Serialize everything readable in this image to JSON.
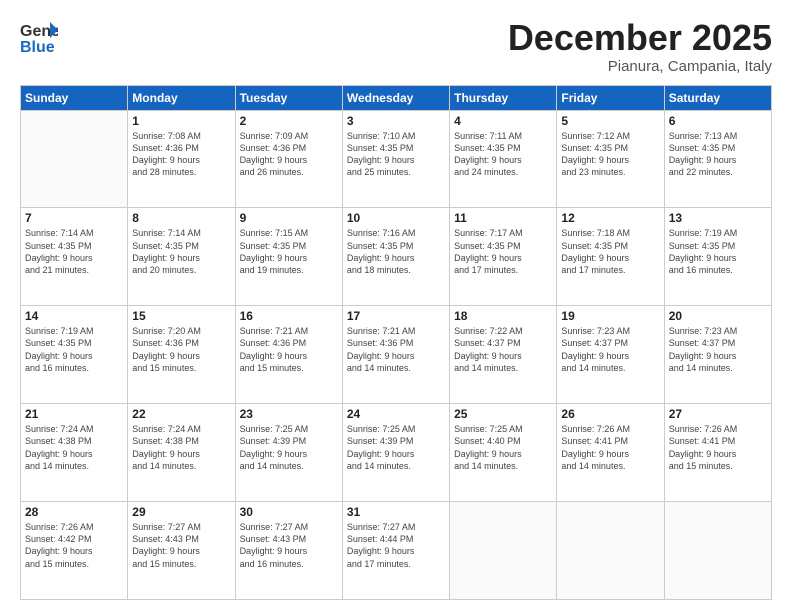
{
  "header": {
    "logo_general": "General",
    "logo_blue": "Blue",
    "month": "December 2025",
    "location": "Pianura, Campania, Italy"
  },
  "weekdays": [
    "Sunday",
    "Monday",
    "Tuesday",
    "Wednesday",
    "Thursday",
    "Friday",
    "Saturday"
  ],
  "weeks": [
    [
      {
        "day": "",
        "info": ""
      },
      {
        "day": "1",
        "info": "Sunrise: 7:08 AM\nSunset: 4:36 PM\nDaylight: 9 hours\nand 28 minutes."
      },
      {
        "day": "2",
        "info": "Sunrise: 7:09 AM\nSunset: 4:36 PM\nDaylight: 9 hours\nand 26 minutes."
      },
      {
        "day": "3",
        "info": "Sunrise: 7:10 AM\nSunset: 4:35 PM\nDaylight: 9 hours\nand 25 minutes."
      },
      {
        "day": "4",
        "info": "Sunrise: 7:11 AM\nSunset: 4:35 PM\nDaylight: 9 hours\nand 24 minutes."
      },
      {
        "day": "5",
        "info": "Sunrise: 7:12 AM\nSunset: 4:35 PM\nDaylight: 9 hours\nand 23 minutes."
      },
      {
        "day": "6",
        "info": "Sunrise: 7:13 AM\nSunset: 4:35 PM\nDaylight: 9 hours\nand 22 minutes."
      }
    ],
    [
      {
        "day": "7",
        "info": "Sunrise: 7:14 AM\nSunset: 4:35 PM\nDaylight: 9 hours\nand 21 minutes."
      },
      {
        "day": "8",
        "info": "Sunrise: 7:14 AM\nSunset: 4:35 PM\nDaylight: 9 hours\nand 20 minutes."
      },
      {
        "day": "9",
        "info": "Sunrise: 7:15 AM\nSunset: 4:35 PM\nDaylight: 9 hours\nand 19 minutes."
      },
      {
        "day": "10",
        "info": "Sunrise: 7:16 AM\nSunset: 4:35 PM\nDaylight: 9 hours\nand 18 minutes."
      },
      {
        "day": "11",
        "info": "Sunrise: 7:17 AM\nSunset: 4:35 PM\nDaylight: 9 hours\nand 17 minutes."
      },
      {
        "day": "12",
        "info": "Sunrise: 7:18 AM\nSunset: 4:35 PM\nDaylight: 9 hours\nand 17 minutes."
      },
      {
        "day": "13",
        "info": "Sunrise: 7:19 AM\nSunset: 4:35 PM\nDaylight: 9 hours\nand 16 minutes."
      }
    ],
    [
      {
        "day": "14",
        "info": "Sunrise: 7:19 AM\nSunset: 4:35 PM\nDaylight: 9 hours\nand 16 minutes."
      },
      {
        "day": "15",
        "info": "Sunrise: 7:20 AM\nSunset: 4:36 PM\nDaylight: 9 hours\nand 15 minutes."
      },
      {
        "day": "16",
        "info": "Sunrise: 7:21 AM\nSunset: 4:36 PM\nDaylight: 9 hours\nand 15 minutes."
      },
      {
        "day": "17",
        "info": "Sunrise: 7:21 AM\nSunset: 4:36 PM\nDaylight: 9 hours\nand 14 minutes."
      },
      {
        "day": "18",
        "info": "Sunrise: 7:22 AM\nSunset: 4:37 PM\nDaylight: 9 hours\nand 14 minutes."
      },
      {
        "day": "19",
        "info": "Sunrise: 7:23 AM\nSunset: 4:37 PM\nDaylight: 9 hours\nand 14 minutes."
      },
      {
        "day": "20",
        "info": "Sunrise: 7:23 AM\nSunset: 4:37 PM\nDaylight: 9 hours\nand 14 minutes."
      }
    ],
    [
      {
        "day": "21",
        "info": "Sunrise: 7:24 AM\nSunset: 4:38 PM\nDaylight: 9 hours\nand 14 minutes."
      },
      {
        "day": "22",
        "info": "Sunrise: 7:24 AM\nSunset: 4:38 PM\nDaylight: 9 hours\nand 14 minutes."
      },
      {
        "day": "23",
        "info": "Sunrise: 7:25 AM\nSunset: 4:39 PM\nDaylight: 9 hours\nand 14 minutes."
      },
      {
        "day": "24",
        "info": "Sunrise: 7:25 AM\nSunset: 4:39 PM\nDaylight: 9 hours\nand 14 minutes."
      },
      {
        "day": "25",
        "info": "Sunrise: 7:25 AM\nSunset: 4:40 PM\nDaylight: 9 hours\nand 14 minutes."
      },
      {
        "day": "26",
        "info": "Sunrise: 7:26 AM\nSunset: 4:41 PM\nDaylight: 9 hours\nand 14 minutes."
      },
      {
        "day": "27",
        "info": "Sunrise: 7:26 AM\nSunset: 4:41 PM\nDaylight: 9 hours\nand 15 minutes."
      }
    ],
    [
      {
        "day": "28",
        "info": "Sunrise: 7:26 AM\nSunset: 4:42 PM\nDaylight: 9 hours\nand 15 minutes."
      },
      {
        "day": "29",
        "info": "Sunrise: 7:27 AM\nSunset: 4:43 PM\nDaylight: 9 hours\nand 15 minutes."
      },
      {
        "day": "30",
        "info": "Sunrise: 7:27 AM\nSunset: 4:43 PM\nDaylight: 9 hours\nand 16 minutes."
      },
      {
        "day": "31",
        "info": "Sunrise: 7:27 AM\nSunset: 4:44 PM\nDaylight: 9 hours\nand 17 minutes."
      },
      {
        "day": "",
        "info": ""
      },
      {
        "day": "",
        "info": ""
      },
      {
        "day": "",
        "info": ""
      }
    ]
  ]
}
